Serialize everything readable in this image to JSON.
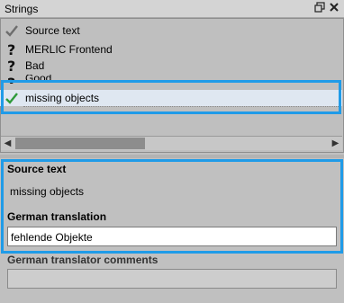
{
  "window": {
    "title": "Strings",
    "float_icon": "float-window-icon",
    "close_icon": "close-icon"
  },
  "list": {
    "header": {
      "label": "Source text",
      "icon": "check-icon"
    },
    "items": [
      {
        "label": "MERLIC Frontend",
        "icon": "question-icon"
      },
      {
        "label": "Bad",
        "icon": "question-icon"
      },
      {
        "label": "Good",
        "icon": "question-icon"
      },
      {
        "label": "missing objects",
        "icon": "check-icon",
        "selected": true
      }
    ]
  },
  "editor": {
    "source_label": "Source text",
    "source_value": "missing objects",
    "translation_label": "German translation",
    "translation_value": "fehlende Objekte",
    "comments_label": "German translator comments",
    "comments_value": ""
  },
  "colors": {
    "highlight": "#1f9be8",
    "check": "#2e9a3a"
  }
}
